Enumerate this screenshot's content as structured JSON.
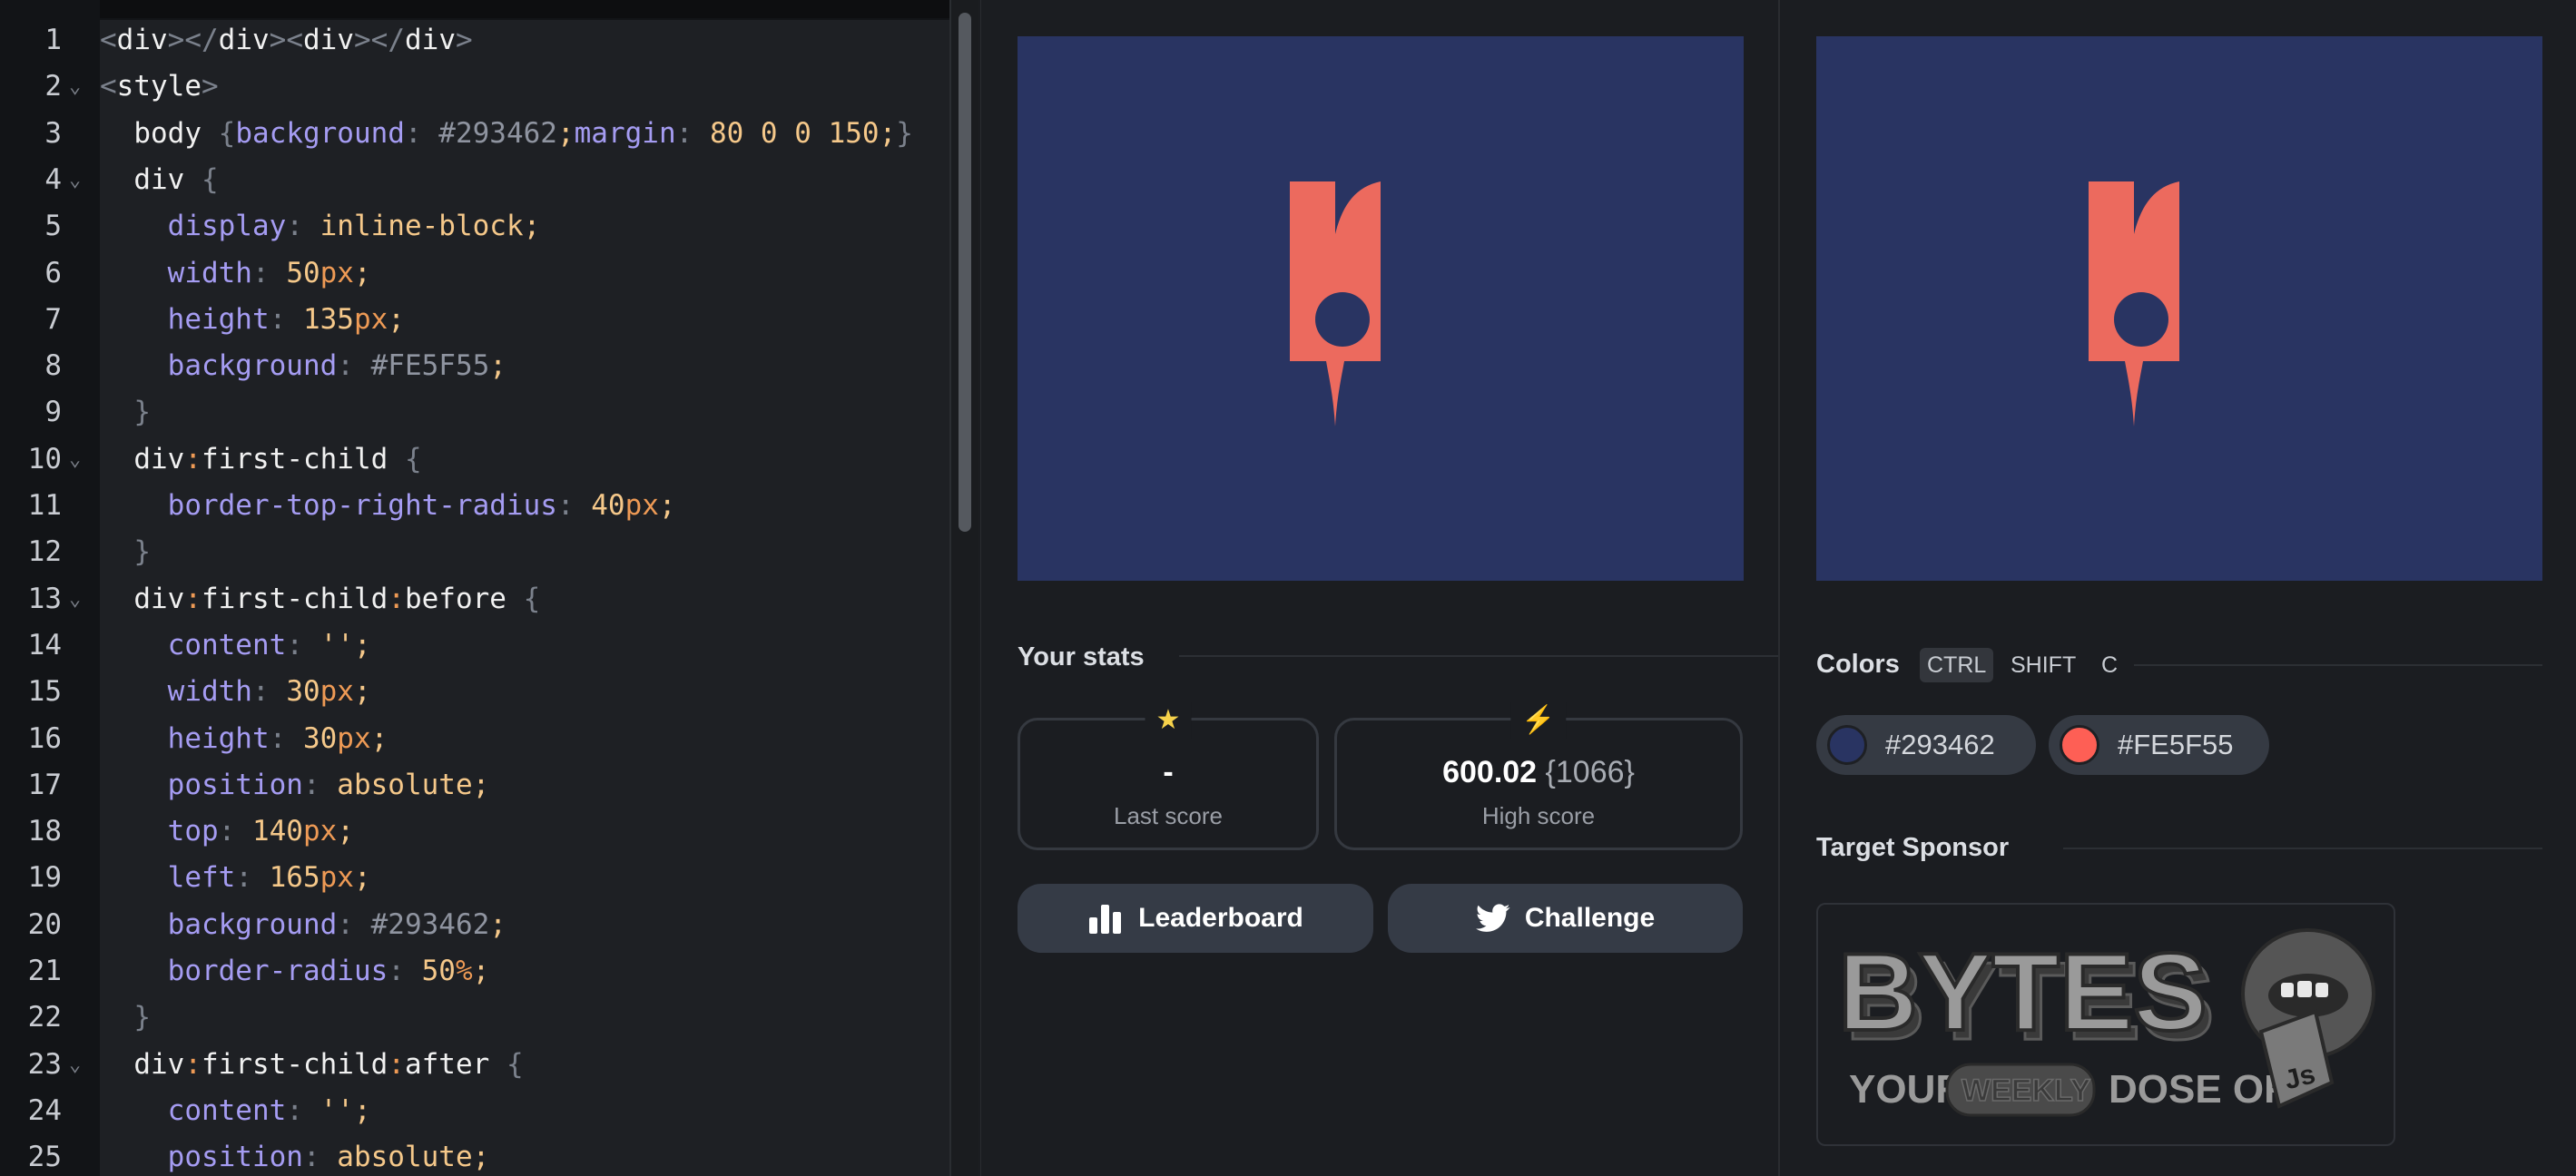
{
  "editor": {
    "lines": [
      {
        "n": "1",
        "fold": "",
        "tokens": [
          [
            "p",
            "<"
          ],
          [
            "s",
            "div"
          ],
          [
            "p",
            "></"
          ],
          [
            "s",
            "div"
          ],
          [
            "p",
            "><"
          ],
          [
            "s",
            "div"
          ],
          [
            "p",
            "></"
          ],
          [
            "s",
            "div"
          ],
          [
            "p",
            ">"
          ]
        ]
      },
      {
        "n": "2",
        "fold": "⌄",
        "tokens": [
          [
            "p",
            "<"
          ],
          [
            "s",
            "style"
          ],
          [
            "p",
            ">"
          ]
        ]
      },
      {
        "n": "3",
        "fold": "",
        "tokens": [
          [
            "x",
            "  "
          ],
          [
            "s",
            "body "
          ],
          [
            "p",
            "{"
          ],
          [
            "k",
            "background"
          ],
          [
            "p",
            ": "
          ],
          [
            "h",
            "#293462"
          ],
          [
            "v",
            ";"
          ],
          [
            "k",
            "margin"
          ],
          [
            "p",
            ": "
          ],
          [
            "v",
            "80 0 0 150;"
          ],
          [
            "p",
            "}"
          ]
        ]
      },
      {
        "n": "4",
        "fold": "⌄",
        "tokens": [
          [
            "x",
            "  "
          ],
          [
            "s",
            "div "
          ],
          [
            "p",
            "{"
          ]
        ]
      },
      {
        "n": "5",
        "fold": "",
        "tokens": [
          [
            "x",
            "    "
          ],
          [
            "k",
            "display"
          ],
          [
            "p",
            ": "
          ],
          [
            "v",
            "inline-block;"
          ]
        ]
      },
      {
        "n": "6",
        "fold": "",
        "tokens": [
          [
            "x",
            "    "
          ],
          [
            "k",
            "width"
          ],
          [
            "p",
            ": "
          ],
          [
            "v",
            "50"
          ],
          [
            "u",
            "px"
          ],
          [
            "v",
            ";"
          ]
        ]
      },
      {
        "n": "7",
        "fold": "",
        "tokens": [
          [
            "x",
            "    "
          ],
          [
            "k",
            "height"
          ],
          [
            "p",
            ": "
          ],
          [
            "v",
            "135"
          ],
          [
            "u",
            "px"
          ],
          [
            "v",
            ";"
          ]
        ]
      },
      {
        "n": "8",
        "fold": "",
        "tokens": [
          [
            "x",
            "    "
          ],
          [
            "k",
            "background"
          ],
          [
            "p",
            ": "
          ],
          [
            "h",
            "#FE5F55"
          ],
          [
            "v",
            ";"
          ]
        ]
      },
      {
        "n": "9",
        "fold": "",
        "tokens": [
          [
            "x",
            "  "
          ],
          [
            "p",
            "}"
          ]
        ]
      },
      {
        "n": "10",
        "fold": "⌄",
        "tokens": [
          [
            "x",
            "  "
          ],
          [
            "s",
            "div"
          ],
          [
            "u",
            ":"
          ],
          [
            "s",
            "first-child "
          ],
          [
            "p",
            "{"
          ]
        ]
      },
      {
        "n": "11",
        "fold": "",
        "tokens": [
          [
            "x",
            "    "
          ],
          [
            "k",
            "border-top-right-radius"
          ],
          [
            "p",
            ": "
          ],
          [
            "v",
            "40"
          ],
          [
            "u",
            "px"
          ],
          [
            "v",
            ";"
          ]
        ]
      },
      {
        "n": "12",
        "fold": "",
        "tokens": [
          [
            "x",
            "  "
          ],
          [
            "p",
            "}"
          ]
        ]
      },
      {
        "n": "13",
        "fold": "⌄",
        "tokens": [
          [
            "x",
            "  "
          ],
          [
            "s",
            "div"
          ],
          [
            "u",
            ":"
          ],
          [
            "s",
            "first-child"
          ],
          [
            "u",
            ":"
          ],
          [
            "s",
            "before "
          ],
          [
            "p",
            "{"
          ]
        ]
      },
      {
        "n": "14",
        "fold": "",
        "tokens": [
          [
            "x",
            "    "
          ],
          [
            "k",
            "content"
          ],
          [
            "p",
            ": "
          ],
          [
            "v",
            "'';"
          ]
        ]
      },
      {
        "n": "15",
        "fold": "",
        "tokens": [
          [
            "x",
            "    "
          ],
          [
            "k",
            "width"
          ],
          [
            "p",
            ": "
          ],
          [
            "v",
            "30"
          ],
          [
            "u",
            "px"
          ],
          [
            "v",
            ";"
          ]
        ]
      },
      {
        "n": "16",
        "fold": "",
        "tokens": [
          [
            "x",
            "    "
          ],
          [
            "k",
            "height"
          ],
          [
            "p",
            ": "
          ],
          [
            "v",
            "30"
          ],
          [
            "u",
            "px"
          ],
          [
            "v",
            ";"
          ]
        ]
      },
      {
        "n": "17",
        "fold": "",
        "tokens": [
          [
            "x",
            "    "
          ],
          [
            "k",
            "position"
          ],
          [
            "p",
            ": "
          ],
          [
            "v",
            "absolute;"
          ]
        ]
      },
      {
        "n": "18",
        "fold": "",
        "tokens": [
          [
            "x",
            "    "
          ],
          [
            "k",
            "top"
          ],
          [
            "p",
            ": "
          ],
          [
            "v",
            "140"
          ],
          [
            "u",
            "px"
          ],
          [
            "v",
            ";"
          ]
        ]
      },
      {
        "n": "19",
        "fold": "",
        "tokens": [
          [
            "x",
            "    "
          ],
          [
            "k",
            "left"
          ],
          [
            "p",
            ": "
          ],
          [
            "v",
            "165"
          ],
          [
            "u",
            "px"
          ],
          [
            "v",
            ";"
          ]
        ]
      },
      {
        "n": "20",
        "fold": "",
        "tokens": [
          [
            "x",
            "    "
          ],
          [
            "k",
            "background"
          ],
          [
            "p",
            ": "
          ],
          [
            "h",
            "#293462"
          ],
          [
            "v",
            ";"
          ]
        ]
      },
      {
        "n": "21",
        "fold": "",
        "tokens": [
          [
            "x",
            "    "
          ],
          [
            "k",
            "border-radius"
          ],
          [
            "p",
            ": "
          ],
          [
            "v",
            "50"
          ],
          [
            "u",
            "%"
          ],
          [
            "v",
            ";"
          ]
        ]
      },
      {
        "n": "22",
        "fold": "",
        "tokens": [
          [
            "x",
            "  "
          ],
          [
            "p",
            "}"
          ]
        ]
      },
      {
        "n": "23",
        "fold": "⌄",
        "tokens": [
          [
            "x",
            "  "
          ],
          [
            "s",
            "div"
          ],
          [
            "u",
            ":"
          ],
          [
            "s",
            "first-child"
          ],
          [
            "u",
            ":"
          ],
          [
            "s",
            "after "
          ],
          [
            "p",
            "{"
          ]
        ]
      },
      {
        "n": "24",
        "fold": "",
        "tokens": [
          [
            "x",
            "    "
          ],
          [
            "k",
            "content"
          ],
          [
            "p",
            ": "
          ],
          [
            "v",
            "'';"
          ]
        ]
      },
      {
        "n": "25",
        "fold": "",
        "tokens": [
          [
            "x",
            "    "
          ],
          [
            "k",
            "position"
          ],
          [
            "p",
            ": "
          ],
          [
            "v",
            "absolute;"
          ]
        ]
      }
    ]
  },
  "stats": {
    "title": "Your stats",
    "last_score": {
      "icon": "star-icon",
      "value": "-",
      "label": "Last score"
    },
    "high_score": {
      "icon": "lightning-icon",
      "value": "600.02",
      "extra": "{1066}",
      "label": "High score"
    },
    "leaderboard_label": "Leaderboard",
    "challenge_label": "Challenge"
  },
  "colors": {
    "title": "Colors",
    "keys": [
      "CTRL",
      "SHIFT",
      "C"
    ],
    "swatches": [
      {
        "hex": "#293462"
      },
      {
        "hex": "#FE5F55"
      }
    ]
  },
  "sponsor": {
    "title": "Target Sponsor",
    "brand": "BYTES",
    "tagline_your": "YOUR",
    "tagline_weekly": "WEEKLY",
    "tagline_doseof": "DOSE OF",
    "js": "Js"
  },
  "palette": {
    "background": "#293462",
    "shape": "#FE5F55",
    "shape_rendered": "#EC6A5E"
  }
}
